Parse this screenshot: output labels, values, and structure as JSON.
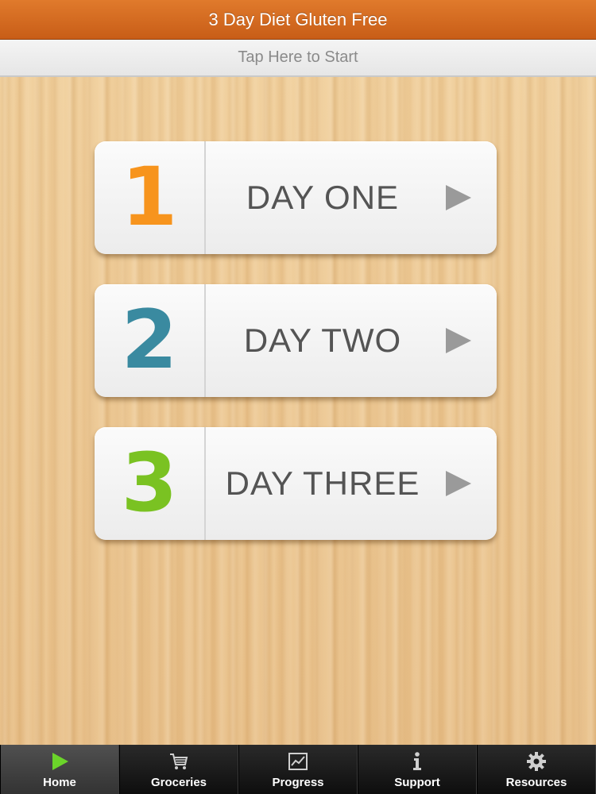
{
  "app": {
    "title": "3 Day Diet Gluten Free"
  },
  "start_bar": {
    "label": "Tap Here to Start"
  },
  "days": [
    {
      "number": "1",
      "label": "DAY ONE",
      "color": "#f7941d",
      "icon": "play-arrow-icon"
    },
    {
      "number": "2",
      "label": "DAY TWO",
      "color": "#3a8aa0",
      "icon": "play-arrow-icon"
    },
    {
      "number": "3",
      "label": "DAY THREE",
      "color": "#7ac222",
      "icon": "play-arrow-icon"
    }
  ],
  "tabs": [
    {
      "label": "Home",
      "icon": "play-icon",
      "active": true
    },
    {
      "label": "Groceries",
      "icon": "cart-icon",
      "active": false
    },
    {
      "label": "Progress",
      "icon": "chart-icon",
      "active": false
    },
    {
      "label": "Support",
      "icon": "info-icon",
      "active": false
    },
    {
      "label": "Resources",
      "icon": "gear-icon",
      "active": false
    }
  ],
  "colors": {
    "title_bar": "#d06a1f",
    "wood": "#e9c48e",
    "tab_active_icon": "#6bd42a"
  }
}
